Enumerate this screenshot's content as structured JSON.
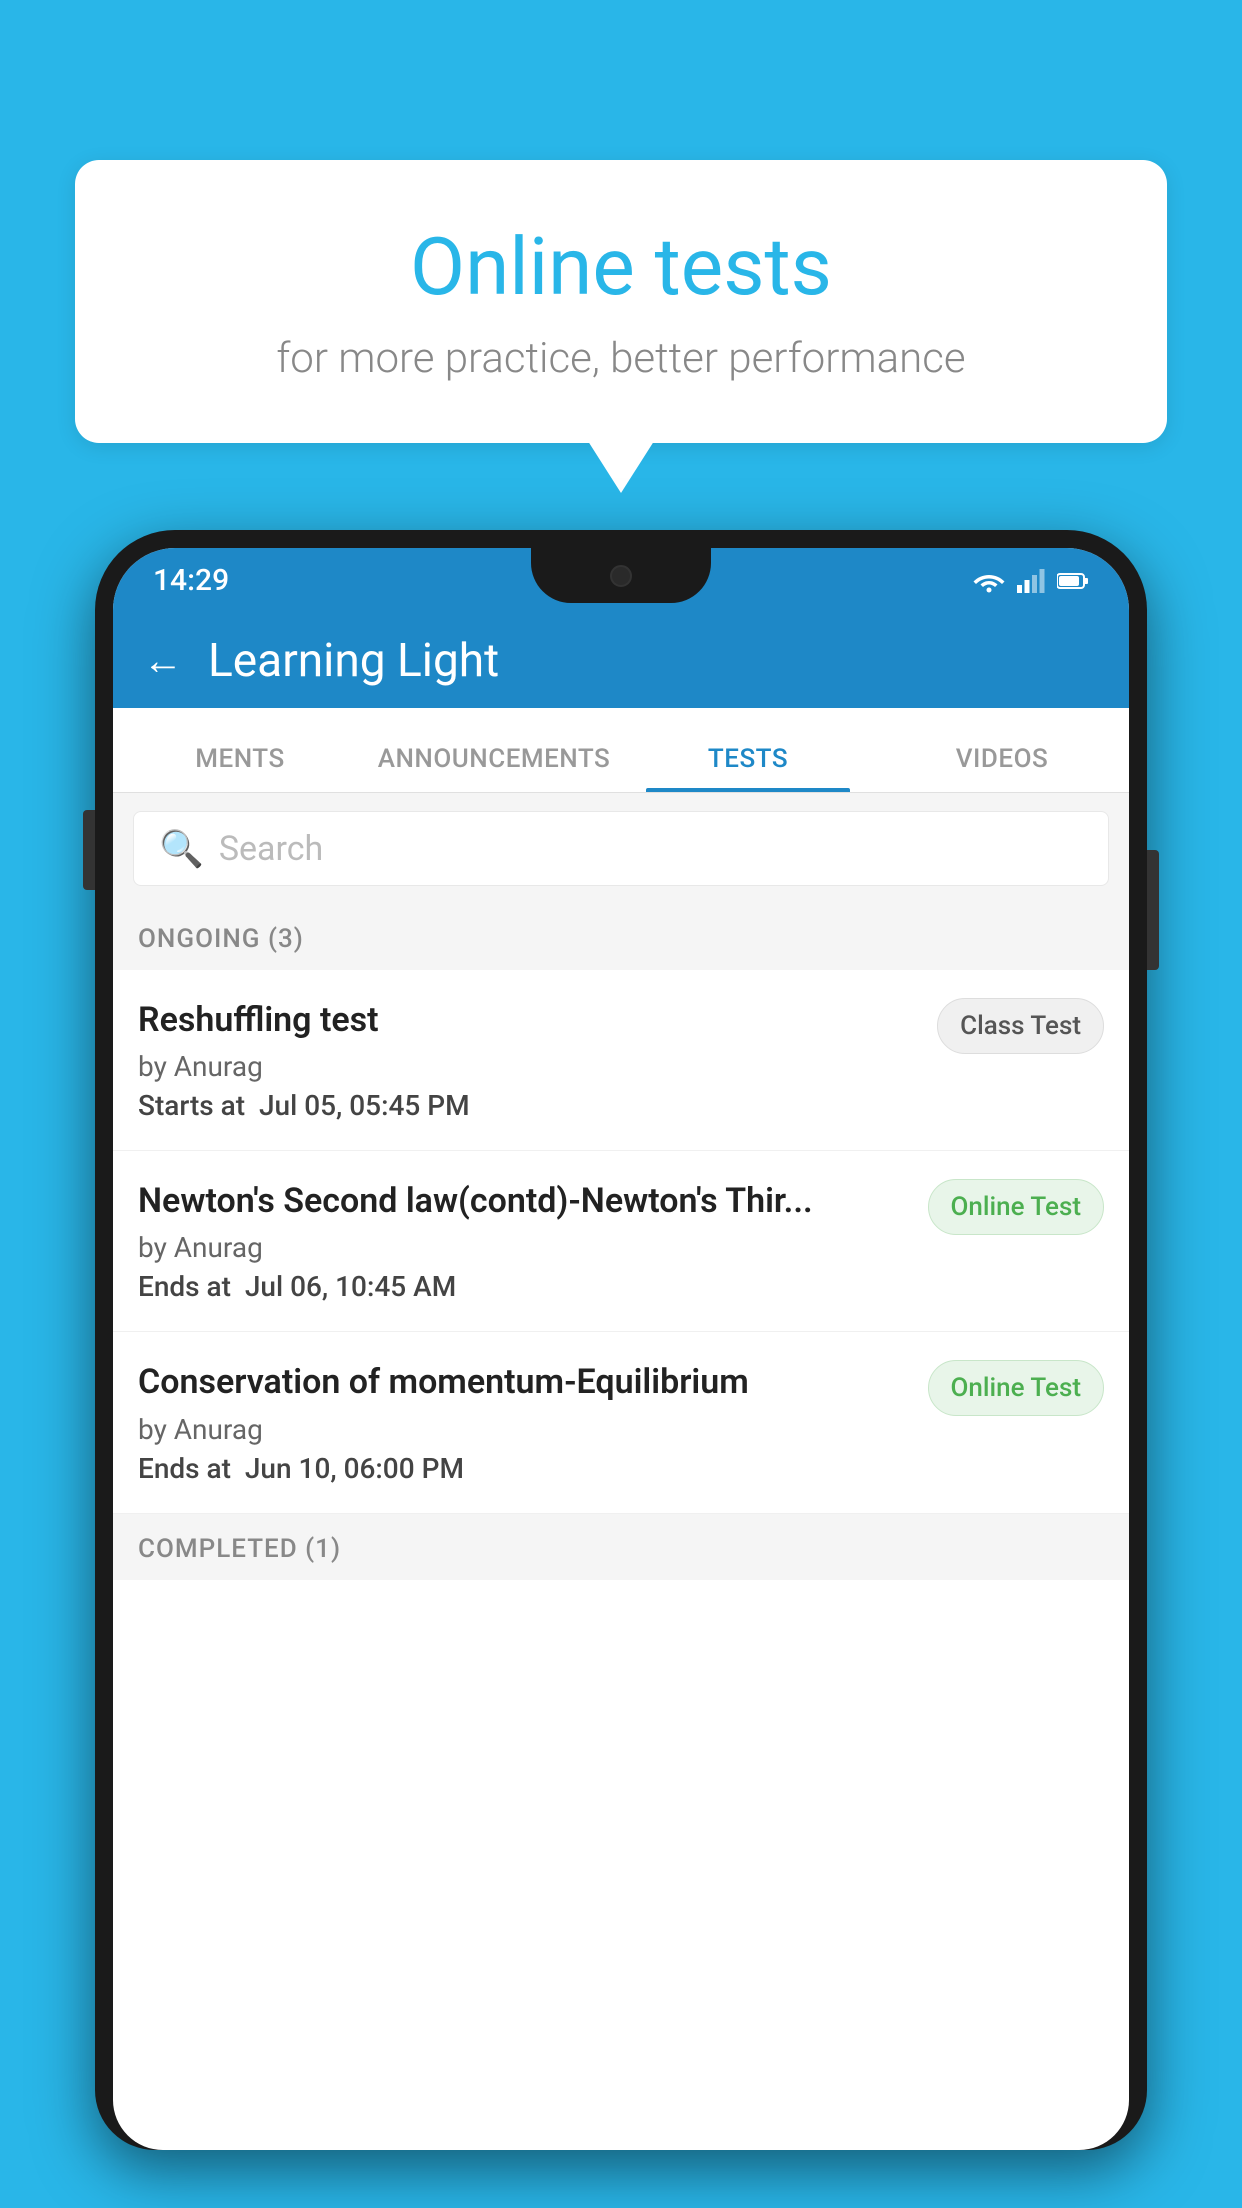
{
  "background_color": "#29b6e8",
  "bubble": {
    "title": "Online tests",
    "subtitle": "for more practice, better performance"
  },
  "status_bar": {
    "time": "14:29",
    "wifi_icon": "wifi-icon",
    "signal_icon": "signal-icon",
    "battery_icon": "battery-icon"
  },
  "header": {
    "back_label": "←",
    "title": "Learning Light"
  },
  "tabs": [
    {
      "label": "MENTS",
      "active": false
    },
    {
      "label": "ANNOUNCEMENTS",
      "active": false
    },
    {
      "label": "TESTS",
      "active": true
    },
    {
      "label": "VIDEOS",
      "active": false
    }
  ],
  "search": {
    "placeholder": "Search"
  },
  "ongoing_section": {
    "label": "ONGOING (3)"
  },
  "tests": [
    {
      "name": "Reshuffling test",
      "author": "by Anurag",
      "date_label": "Starts at",
      "date_value": "Jul 05, 05:45 PM",
      "badge": "Class Test",
      "badge_type": "class"
    },
    {
      "name": "Newton's Second law(contd)-Newton's Thir...",
      "author": "by Anurag",
      "date_label": "Ends at",
      "date_value": "Jul 06, 10:45 AM",
      "badge": "Online Test",
      "badge_type": "online"
    },
    {
      "name": "Conservation of momentum-Equilibrium",
      "author": "by Anurag",
      "date_label": "Ends at",
      "date_value": "Jun 10, 06:00 PM",
      "badge": "Online Test",
      "badge_type": "online"
    }
  ],
  "completed_section": {
    "label": "COMPLETED (1)"
  }
}
